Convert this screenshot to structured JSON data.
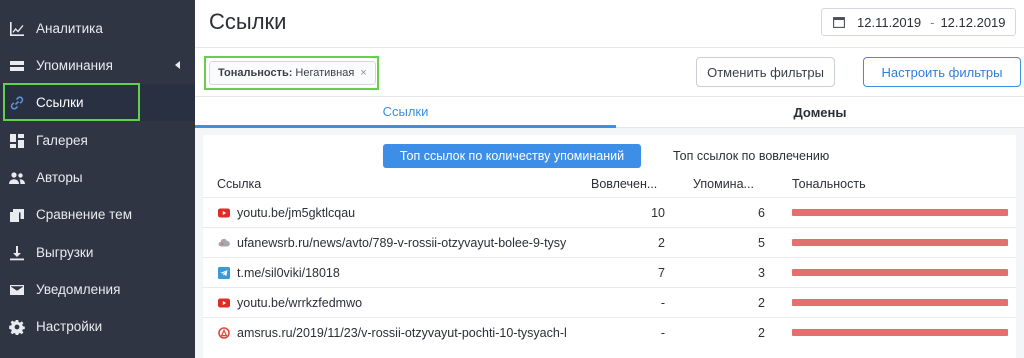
{
  "sidebar": {
    "items": [
      {
        "label": "Аналитика",
        "icon": "chart-icon"
      },
      {
        "label": "Упоминания",
        "icon": "list-icon"
      },
      {
        "label": "Ссылки",
        "icon": "link-icon"
      },
      {
        "label": "Галерея",
        "icon": "gallery-icon"
      },
      {
        "label": "Авторы",
        "icon": "people-icon"
      },
      {
        "label": "Сравнение тем",
        "icon": "compare-icon"
      },
      {
        "label": "Выгрузки",
        "icon": "download-icon"
      },
      {
        "label": "Уведомления",
        "icon": "mail-icon"
      },
      {
        "label": "Настройки",
        "icon": "gear-icon"
      }
    ],
    "active_index": 2
  },
  "header": {
    "title": "Ссылки",
    "date_from": "12.11.2019",
    "date_separator": "-",
    "date_to": "12.12.2019"
  },
  "filters": {
    "chip_key": "Тональность:",
    "chip_value": "Негативная",
    "chip_close": "×",
    "reset_label": "Отменить фильтры",
    "configure_label": "Настроить фильтры"
  },
  "tabs": [
    {
      "label": "Ссылки",
      "active": true
    },
    {
      "label": "Домены",
      "active": false
    }
  ],
  "segments": {
    "active_label": "Топ ссылок по количеству упоминаний",
    "inactive_label": "Топ ссылок по вовлечению"
  },
  "table": {
    "headers": {
      "link": "Ссылка",
      "engagement": "Вовлечен...",
      "mentions": "Упомина...",
      "tonality": "Тональность"
    },
    "rows": [
      {
        "icon": "youtube-icon",
        "url": "youtu.be/jm5gktlcqau",
        "engagement": "10",
        "mentions": "6",
        "negative_share": 1.0
      },
      {
        "icon": "cloud-icon",
        "url": "ufanewsrb.ru/news/avto/789-v-rossii-otzyvayut-bolee-9-tysy",
        "engagement": "2",
        "mentions": "5",
        "negative_share": 1.0
      },
      {
        "icon": "telegram-icon",
        "url": "t.me/sil0viki/18018",
        "engagement": "7",
        "mentions": "3",
        "negative_share": 1.0
      },
      {
        "icon": "youtube-icon",
        "url": "youtu.be/wrrkzfedmwo",
        "engagement": "-",
        "mentions": "2",
        "negative_share": 1.0
      },
      {
        "icon": "site-icon",
        "url": "amsrus.ru/2019/11/23/v-rossii-otzyvayut-pochti-10-tysyach-l",
        "engagement": "-",
        "mentions": "2",
        "negative_share": 1.0
      }
    ]
  },
  "colors": {
    "sidebar_bg": "#2f3542",
    "accent": "#3d8ee6",
    "negative": "#e3706f",
    "highlight": "#66d04a"
  }
}
